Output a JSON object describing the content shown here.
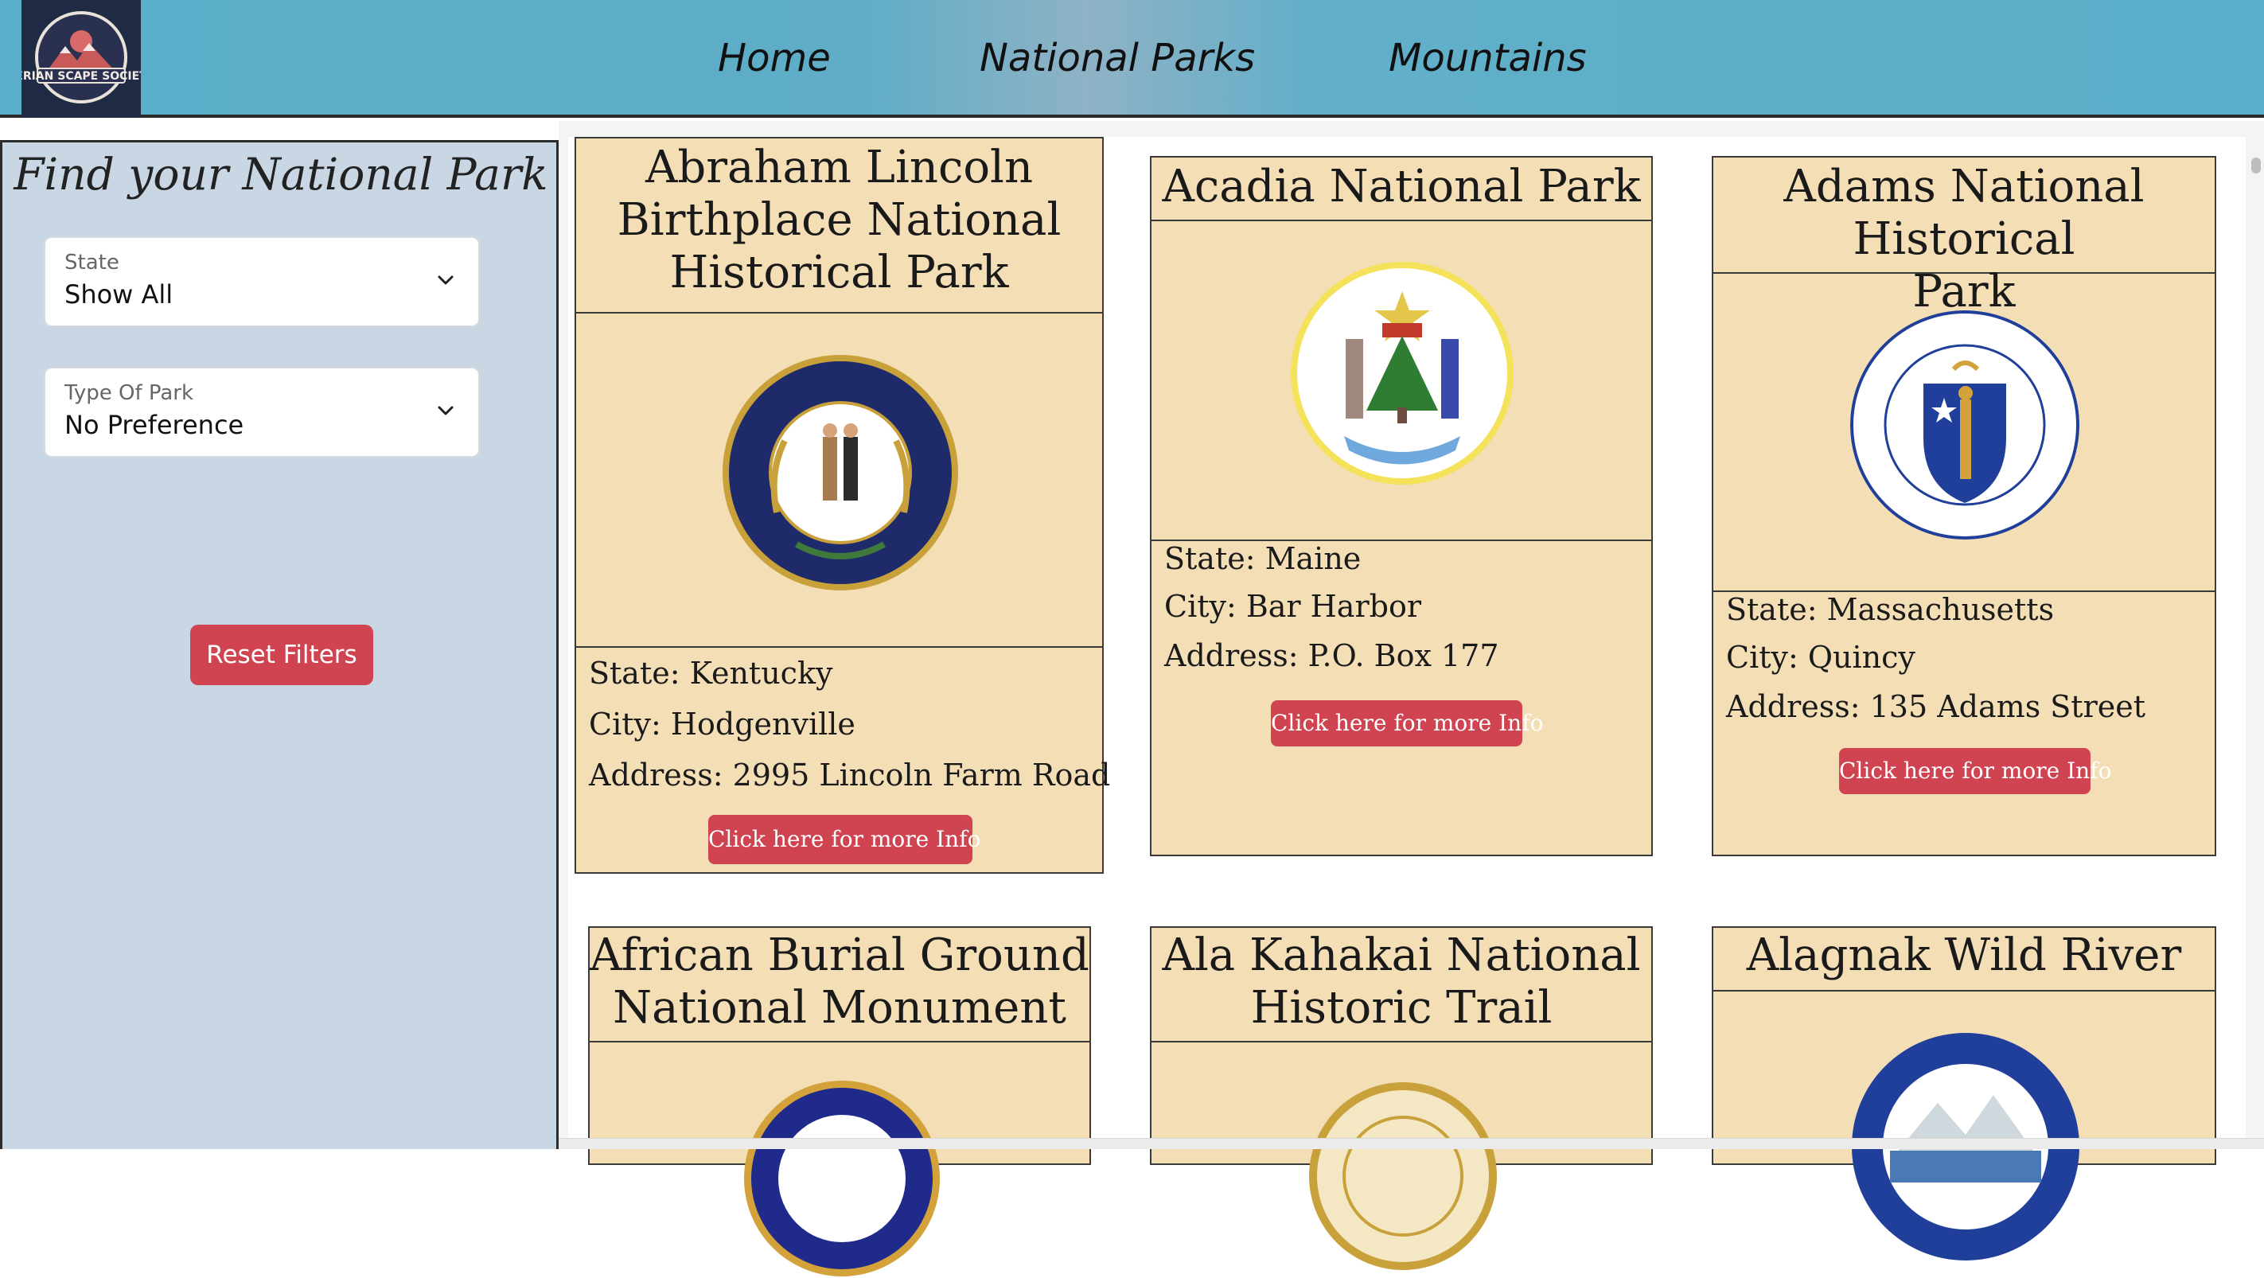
{
  "header": {
    "logo_text": "SERIAN SCAPE SOCIETY",
    "nav": [
      "Home",
      "National Parks",
      "Mountains"
    ]
  },
  "sidebar": {
    "title": "Find your National Park",
    "filters": [
      {
        "label": "State",
        "value": "Show All"
      },
      {
        "label": "Type Of Park",
        "value": "No Preference"
      }
    ],
    "reset_label": "Reset Filters"
  },
  "cards": [
    {
      "title": "Abraham Lincoln Birthplace National Historical Park",
      "title_lines": [
        "Abraham Lincoln",
        "Birthplace National",
        "Historical Park"
      ],
      "seal": "kentucky-seal-icon",
      "state": "State: Kentucky",
      "city": "City: Hodgenville",
      "address": "Address: 2995 Lincoln Farm Road",
      "button": "Click here for more Info"
    },
    {
      "title": "Acadia National Park",
      "title_lines": [
        "Acadia National Park"
      ],
      "seal": "maine-seal-icon",
      "state": "State: Maine",
      "city": "City: Bar Harbor",
      "address": "Address: P.O. Box 177",
      "button": "Click here for more Info"
    },
    {
      "title": "Adams National Historical Park",
      "title_lines": [
        "Adams National Historical",
        "Park"
      ],
      "seal": "massachusetts-seal-icon",
      "state": "State: Massachusetts",
      "city": "City: Quincy",
      "address": "Address: 135 Adams Street",
      "button": "Click here for more Info"
    },
    {
      "title": "African Burial Ground National Monument",
      "title_lines": [
        "African Burial Ground",
        "National Monument"
      ],
      "seal": "new-york-seal-icon"
    },
    {
      "title": "Ala Kahakai National Historic Trail",
      "title_lines": [
        "Ala Kahakai National",
        "Historic Trail"
      ],
      "seal": "hawaii-seal-icon"
    },
    {
      "title": "Alagnak Wild River",
      "title_lines": [
        "Alagnak Wild River"
      ],
      "seal": "alaska-seal-icon"
    }
  ],
  "colors": {
    "header": "#5aaec9",
    "sidebar": "#c9d7e4",
    "card": "#f3deb6",
    "button": "#d04451"
  }
}
